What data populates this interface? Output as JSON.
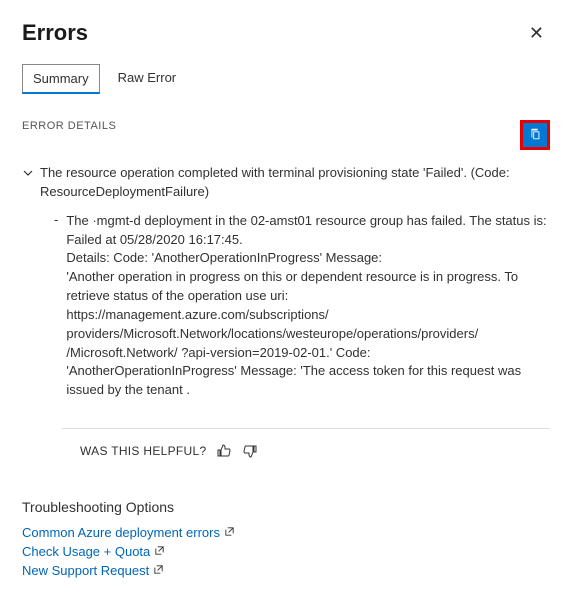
{
  "header": {
    "title": "Errors"
  },
  "tabs": {
    "summary": "Summary",
    "raw": "Raw Error"
  },
  "details": {
    "section_label": "ERROR DETAILS",
    "main_message": "The resource operation completed with terminal provisioning state 'Failed'. (Code: ResourceDeploymentFailure)",
    "sub_message": "The   ·mgmt-d deployment in the 02-amst01 resource group has failed. The status is: Failed at  05/28/2020 16:17:45.\nDetails: Code: 'AnotherOperationInProgress' Message:\n'Another operation in progress on this or dependent resource is in progress. To retrieve status of the operation use uri:  https://management.azure.com/subscriptions/ providers/Microsoft.Network/locations/westeurope/operations/providers/  /Microsoft.Network/ ?api-version=2019-02-01.' Code:\n 'AnotherOperationInProgress'     Message: 'The access token for this request was issued by the tenant ."
  },
  "helpful": {
    "label": "WAS THIS HELPFUL?"
  },
  "troubleshoot": {
    "title": "Troubleshooting Options",
    "links": {
      "common": "Common Azure deployment errors",
      "usage": "Check Usage + Quota",
      "support": "New Support Request"
    }
  }
}
